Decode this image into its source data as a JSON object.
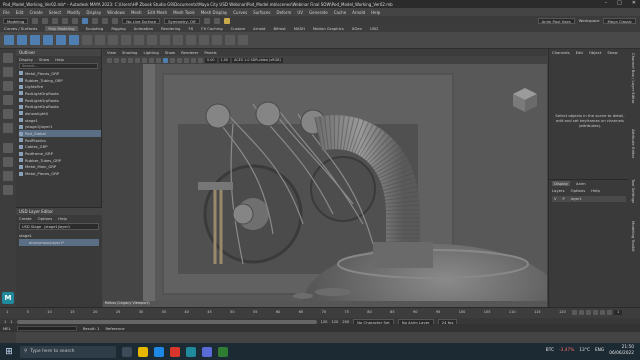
{
  "window": {
    "title": "Pod_Model_Working_Ver02.mb* - Autodesk MAYA 2023: C:\\Users\\HP Zbook Studio G9\\Documents\\Maya City USD Webinar\\Pod_Model.mb\\scenes\\Webinar Final SOW\\Pod_Model_Working_Ver02.mb"
  },
  "menubar": {
    "items": [
      "File",
      "Edit",
      "Create",
      "Select",
      "Modify",
      "Display",
      "Windows",
      "Mesh",
      "Edit Mesh",
      "Mesh Tools",
      "Mesh Display",
      "Curves",
      "Surfaces",
      "Deform",
      "UV",
      "Generate",
      "Cache",
      "Arnold",
      "Help"
    ]
  },
  "statusline": {
    "mode": "Modeling",
    "live_surface": "No Live Surface",
    "symmetry": "Symmetry: Off",
    "user": "Anim Paul Uses",
    "workspace_label": "Workspace",
    "workspace": "Maya Classic"
  },
  "shelf": {
    "tabs": [
      "Curves / Surfaces",
      "Poly Modeling",
      "Sculpting",
      "Rigging",
      "Animation",
      "Rendering",
      "FX",
      "FX Caching",
      "Custom",
      "Arnold",
      "Bifrost",
      "MASH",
      "Motion Graphics",
      "XGen",
      "USD"
    ],
    "active_tab": "Poly Modeling"
  },
  "outliner": {
    "title": "Outliner",
    "menu": [
      "Display",
      "Show",
      "Help"
    ],
    "search_placeholder": "Search...",
    "items": [
      "Metal_Pieces_GRP",
      "Rubber_Tubing_GRP",
      "LightsFire",
      "PodLightGrpRoots",
      "PodLightGrpRoots",
      "PodLightGrpRoots",
      "dshowlight0",
      "stage1",
      "|stage1|layer1",
      "Pod_Global",
      "PodPlastics",
      "Cables_GRP",
      "Podframe_GRP",
      "Rubber_Tubes_GRP",
      "Metal_Main_GRP",
      "Metal_Pieces_GRP"
    ],
    "selected_index": 9
  },
  "usd": {
    "title": "USD Layer Editor",
    "menu": [
      "Create",
      "Options",
      "Help"
    ],
    "stage_label": "USD Stage",
    "stage_value": "|stage1|layer1",
    "layer": "anonymousLayer1*",
    "root": "stage1"
  },
  "viewport": {
    "menu": [
      "View",
      "Shading",
      "Lighting",
      "Show",
      "Renderer",
      "Panels"
    ],
    "fields": [
      "0.00",
      "1.00",
      "ACES 1.0 SDR-video (sRGB)"
    ],
    "footer": "Rebus (Legacy Viewport)"
  },
  "channelbox": {
    "tabs": [
      "Channels",
      "Edit",
      "Object",
      "Show"
    ],
    "message": "Select objects in the scene to detail, edit and set keyframes on channels (attributes).",
    "layer_tabs": [
      "Display",
      "Anim"
    ],
    "layer_menu": [
      "Layers",
      "Options",
      "Help"
    ],
    "layer_row": {
      "v": "V",
      "p": "P",
      "name": "layer1"
    }
  },
  "side_tabs": [
    "Channel Box / Layer Editor",
    "Attribute Editor",
    "Tool Settings",
    "Modeling Toolkit"
  ],
  "timeline": {
    "ticks": [
      "1",
      "5",
      "10",
      "15",
      "20",
      "25",
      "30",
      "35",
      "40",
      "45",
      "50",
      "55",
      "60",
      "65",
      "70",
      "75",
      "80",
      "85",
      "90",
      "95",
      "100",
      "105",
      "110",
      "115",
      "120"
    ],
    "current_frame": "1",
    "range_start": "1",
    "range_start_inner": "1",
    "range_end_inner": "120",
    "range_end": "120",
    "anim_end": "200",
    "char_set": "No Character Set",
    "anim_layer": "No Anim Layer",
    "fps": "24 fps"
  },
  "cmdline": {
    "label": "MEL",
    "reference": "Reference",
    "count": "Result: 1"
  },
  "taskbar": {
    "search_placeholder": "Type here to search",
    "weather": "BTC",
    "stock_change": "-3.47%",
    "temp": "13°C",
    "lang": "ENG",
    "time": "21:50",
    "date": "06/06/2022"
  }
}
